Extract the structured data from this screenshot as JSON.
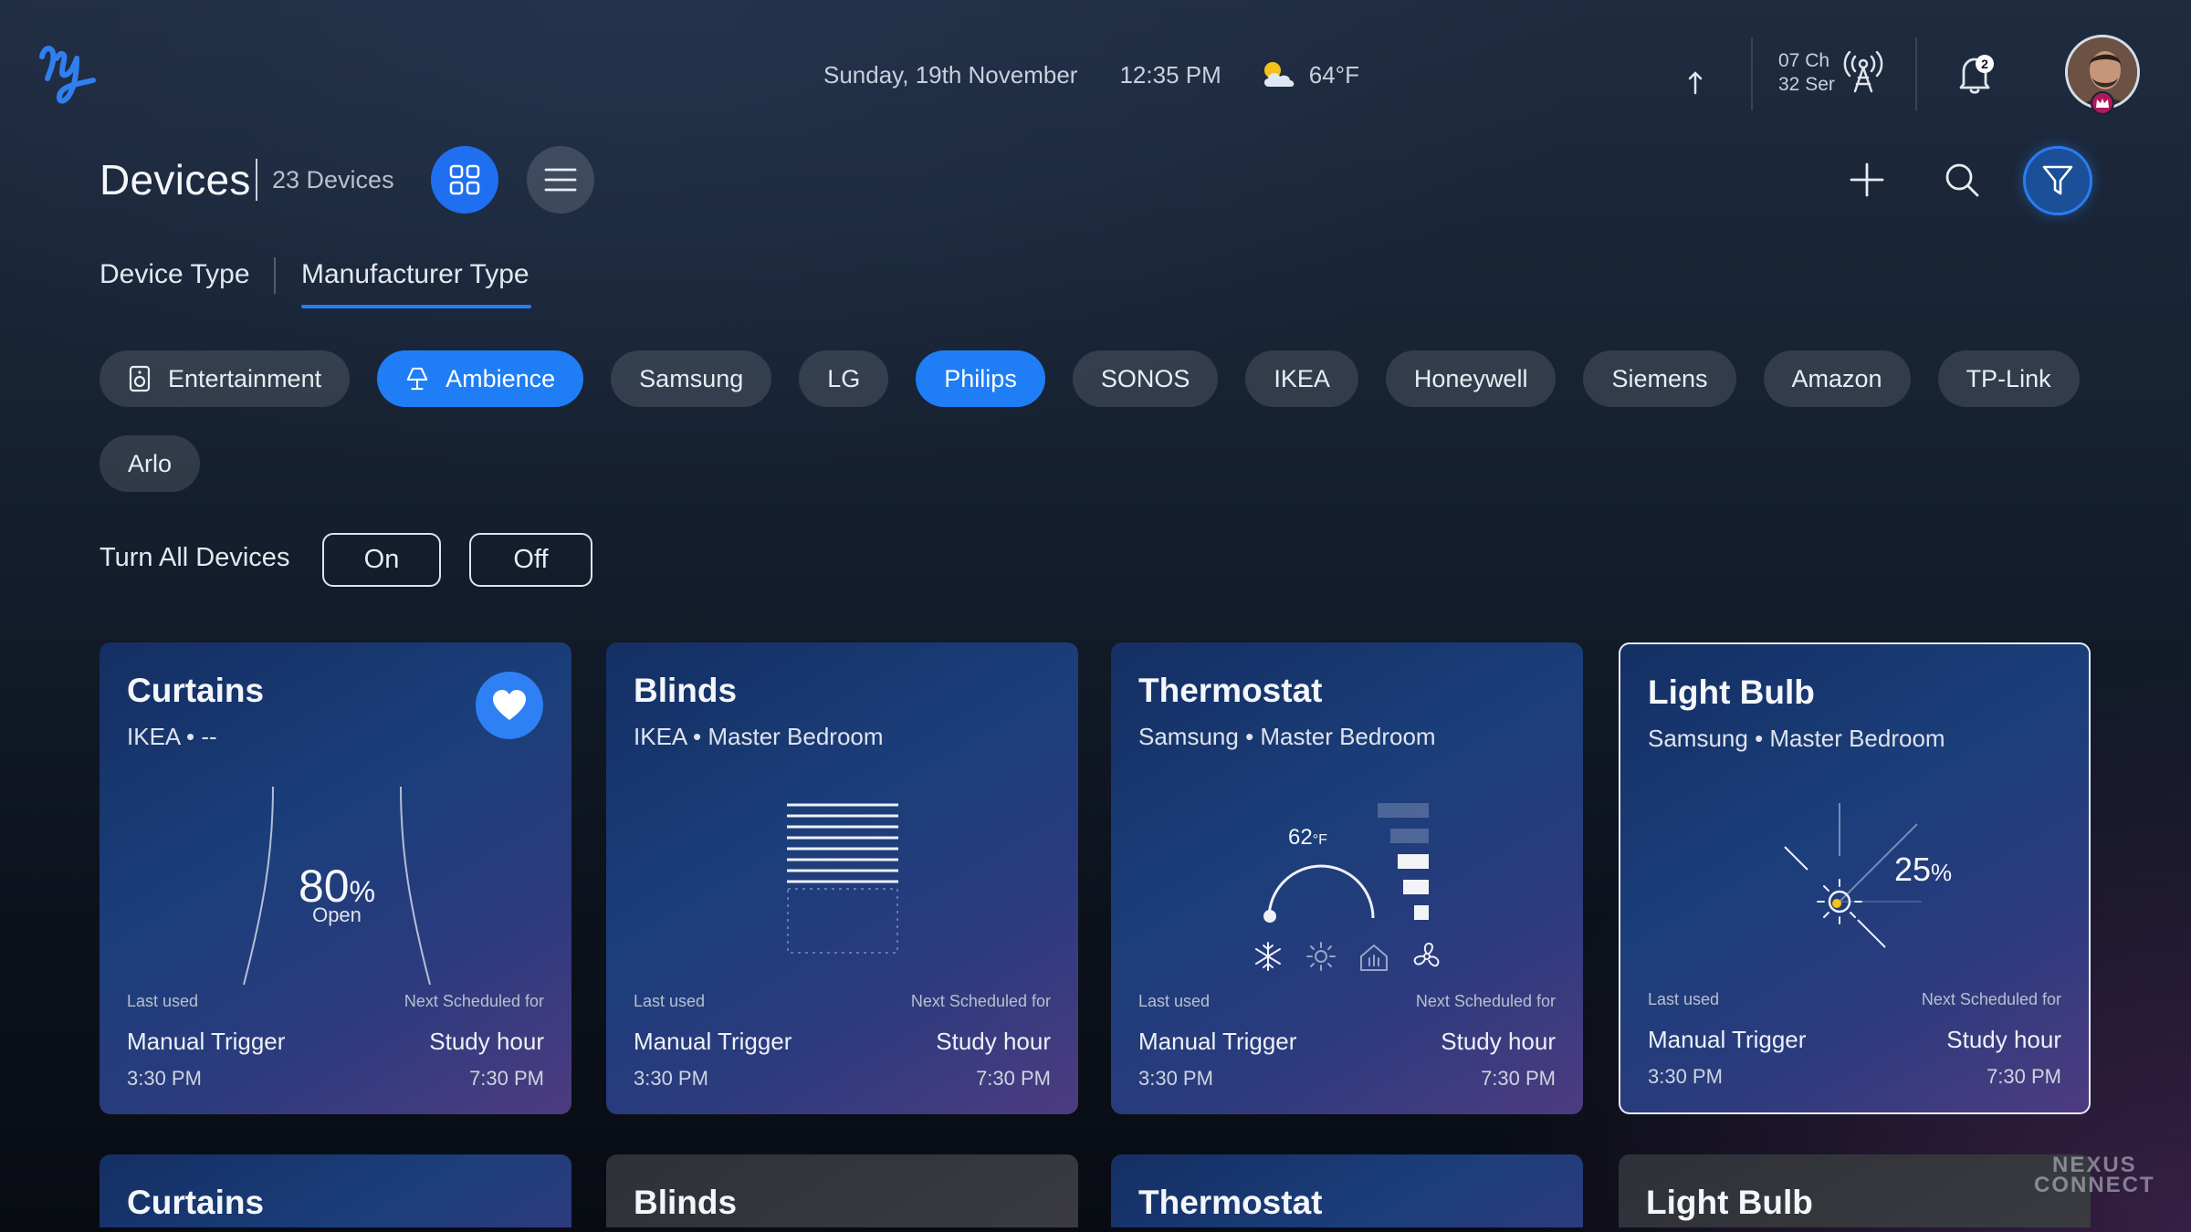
{
  "topbar": {
    "date": "Sunday, 19th November",
    "time": "12:35 PM",
    "weather_temp": "64°F",
    "channel_line1": "07 Ch",
    "channel_line2": "32 Ser",
    "notification_count": "2"
  },
  "header": {
    "title": "Devices",
    "count": "23 Devices"
  },
  "tabs": [
    {
      "label": "Device Type",
      "active": false
    },
    {
      "label": "Manufacturer Type",
      "active": true
    }
  ],
  "chips": [
    {
      "label": "Entertainment",
      "icon": "speaker-icon",
      "active": false
    },
    {
      "label": "Ambience",
      "icon": "lamp-icon",
      "active": true
    },
    {
      "label": "Samsung",
      "active": false
    },
    {
      "label": "LG",
      "active": false
    },
    {
      "label": "Philips",
      "active": true
    },
    {
      "label": "SONOS",
      "active": false
    },
    {
      "label": "IKEA",
      "active": false
    },
    {
      "label": "Honeywell",
      "active": false
    },
    {
      "label": "Siemens",
      "active": false
    },
    {
      "label": "Amazon",
      "active": false
    },
    {
      "label": "TP-Link",
      "active": false
    },
    {
      "label": "Arlo",
      "active": false
    }
  ],
  "turn_all": {
    "label": "Turn All Devices",
    "on": "On",
    "off": "Off"
  },
  "cards": [
    {
      "title": "Curtains",
      "subtitle": "IKEA • --",
      "favorite": true,
      "value": "80",
      "unit": "%",
      "state": "Open",
      "last_used_label": "Last used",
      "last_used_value": "Manual Trigger",
      "last_used_time": "3:30 PM",
      "next_label": "Next Scheduled for",
      "next_value": "Study hour",
      "next_time": "7:30 PM"
    },
    {
      "title": "Blinds",
      "subtitle": "IKEA • Master Bedroom",
      "last_used_label": "Last used",
      "last_used_value": "Manual Trigger",
      "last_used_time": "3:30 PM",
      "next_label": "Next Scheduled for",
      "next_value": "Study hour",
      "next_time": "7:30 PM"
    },
    {
      "title": "Thermostat",
      "subtitle": "Samsung • Master Bedroom",
      "temp": "62",
      "temp_unit": "°F",
      "last_used_label": "Last used",
      "last_used_value": "Manual Trigger",
      "last_used_time": "3:30 PM",
      "next_label": "Next Scheduled for",
      "next_value": "Study hour",
      "next_time": "7:30 PM"
    },
    {
      "title": "Light Bulb",
      "subtitle": "Samsung • Master Bedroom",
      "value": "25",
      "unit": "%",
      "last_used_label": "Last used",
      "last_used_value": "Manual Trigger",
      "last_used_time": "3:30 PM",
      "next_label": "Next Scheduled for",
      "next_value": "Study hour",
      "next_time": "7:30 PM"
    }
  ],
  "cards_row2": [
    {
      "title": "Curtains"
    },
    {
      "title": "Blinds"
    },
    {
      "title": "Thermostat"
    },
    {
      "title": "Light Bulb"
    }
  ],
  "watermark": {
    "line1": "NEXUS",
    "line2": "CONNECT"
  },
  "colors": {
    "accent": "#1f7ef5",
    "card_start": "#142f63",
    "card_end": "#4e3b80",
    "favorite": "#2f80f5"
  }
}
